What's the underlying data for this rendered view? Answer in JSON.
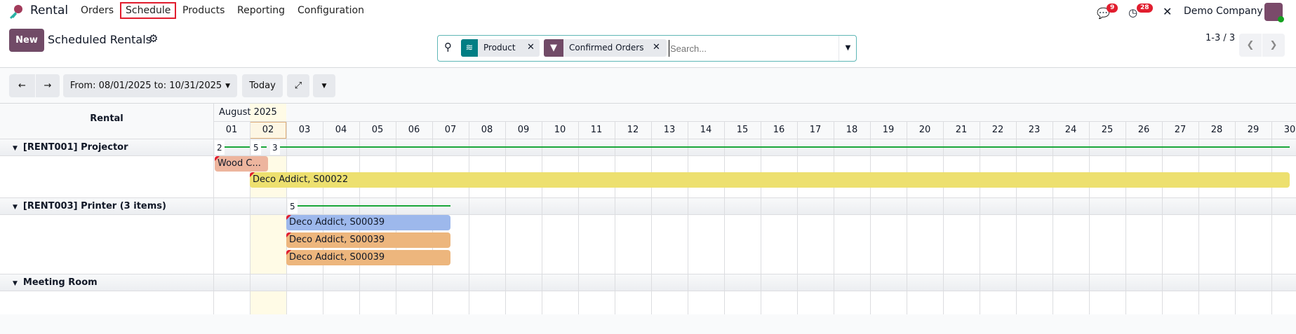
{
  "nav": {
    "app": "Rental",
    "menu": [
      "Orders",
      "Schedule",
      "Products",
      "Reporting",
      "Configuration"
    ],
    "messages_count": "9",
    "activities_count": "28",
    "company": "Demo Company"
  },
  "control": {
    "new_label": "New",
    "title": "Scheduled Rentals",
    "facets": [
      {
        "label": "Product",
        "icon": "layers-icon",
        "color": "#017e84"
      },
      {
        "label": "Confirmed Orders",
        "icon": "filter-icon",
        "color": "#714b67"
      }
    ],
    "search_placeholder": "Search...",
    "pager": "1-3 / 3"
  },
  "toolbar": {
    "range": "From: 08/01/2025 to: 10/31/2025",
    "today": "Today"
  },
  "gantt": {
    "row_header": "Rental",
    "month": "August 2025",
    "today_day": "02",
    "days": [
      "01",
      "02",
      "03",
      "04",
      "05",
      "06",
      "07",
      "08",
      "09",
      "10",
      "11",
      "12",
      "13",
      "14",
      "15",
      "16",
      "17",
      "18",
      "19",
      "20",
      "21",
      "22",
      "23",
      "24",
      "25",
      "26",
      "27",
      "28",
      "29",
      "30"
    ],
    "groups": [
      {
        "label": "[RENT001] Projector",
        "counts": [
          "2",
          "5",
          "3"
        ],
        "pills": [
          {
            "label": "Wood C...",
            "color": "#edb59e"
          },
          {
            "label": "Deco Addict, S00022",
            "color": "#ede06f"
          }
        ]
      },
      {
        "label": "[RENT003] Printer (3 items)",
        "counts": [
          "5"
        ],
        "pills": [
          {
            "label": "Deco Addict, S00039",
            "color": "#9db8ec"
          },
          {
            "label": "Deco Addict, S00039",
            "color": "#edb67d"
          },
          {
            "label": "Deco Addict, S00039",
            "color": "#edb67d"
          }
        ]
      },
      {
        "label": "Meeting Room",
        "counts": [],
        "pills": []
      }
    ]
  }
}
